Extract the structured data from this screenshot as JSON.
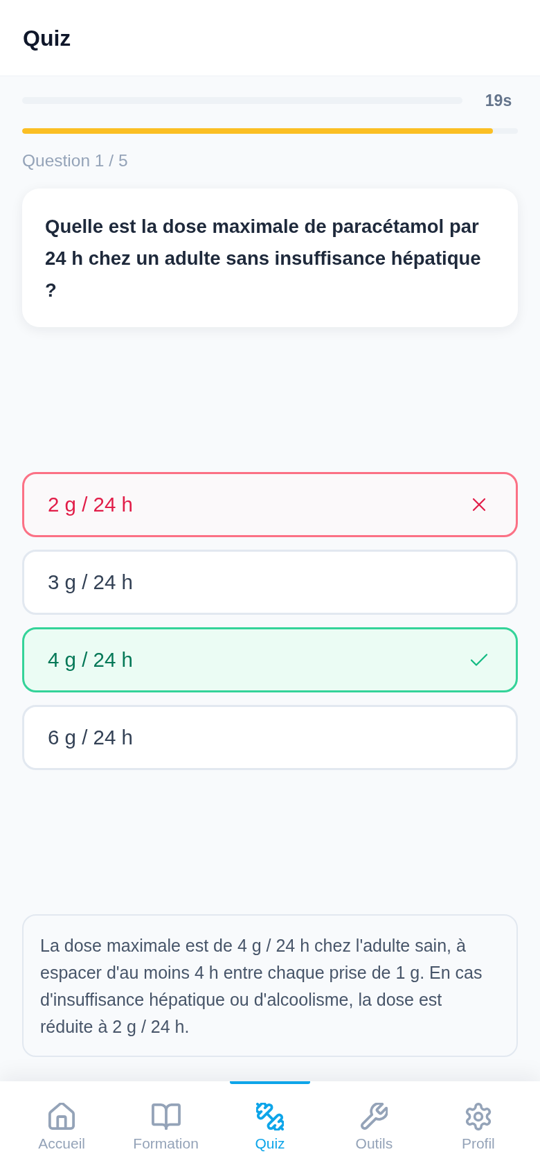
{
  "header": {
    "title": "Quiz"
  },
  "timer": {
    "reading": "19s"
  },
  "time_bar": {
    "level": 0.95
  },
  "question": {
    "counter": "Question 1 / 5",
    "text": "Quelle est la dose maximale de paracétamol par 24 h chez un adulte sans insuffisance hépatique ?"
  },
  "options": [
    {
      "label": "2 g / 24 h",
      "selected": true,
      "correct": false
    },
    {
      "label": "3 g / 24 h",
      "selected": false,
      "correct": false
    },
    {
      "label": "4 g / 24 h",
      "selected": false,
      "correct": true
    },
    {
      "label": "6 g / 24 h",
      "selected": false,
      "correct": false
    }
  ],
  "explanation": {
    "text": "La dose maximale est de 4 g / 24 h chez l'adulte sain, à espacer d'au moins 4 h entre chaque prise de 1 g. En cas d'insuffisance hépatique ou d'alcoolisme, la dose est réduite à 2 g / 24 h."
  },
  "nav": {
    "items": [
      {
        "label": "Accueil",
        "selected": false
      },
      {
        "label": "Formation",
        "selected": false
      },
      {
        "label": "Quiz",
        "selected": true
      },
      {
        "label": "Outils",
        "selected": false
      },
      {
        "label": "Profil",
        "selected": false
      }
    ]
  }
}
